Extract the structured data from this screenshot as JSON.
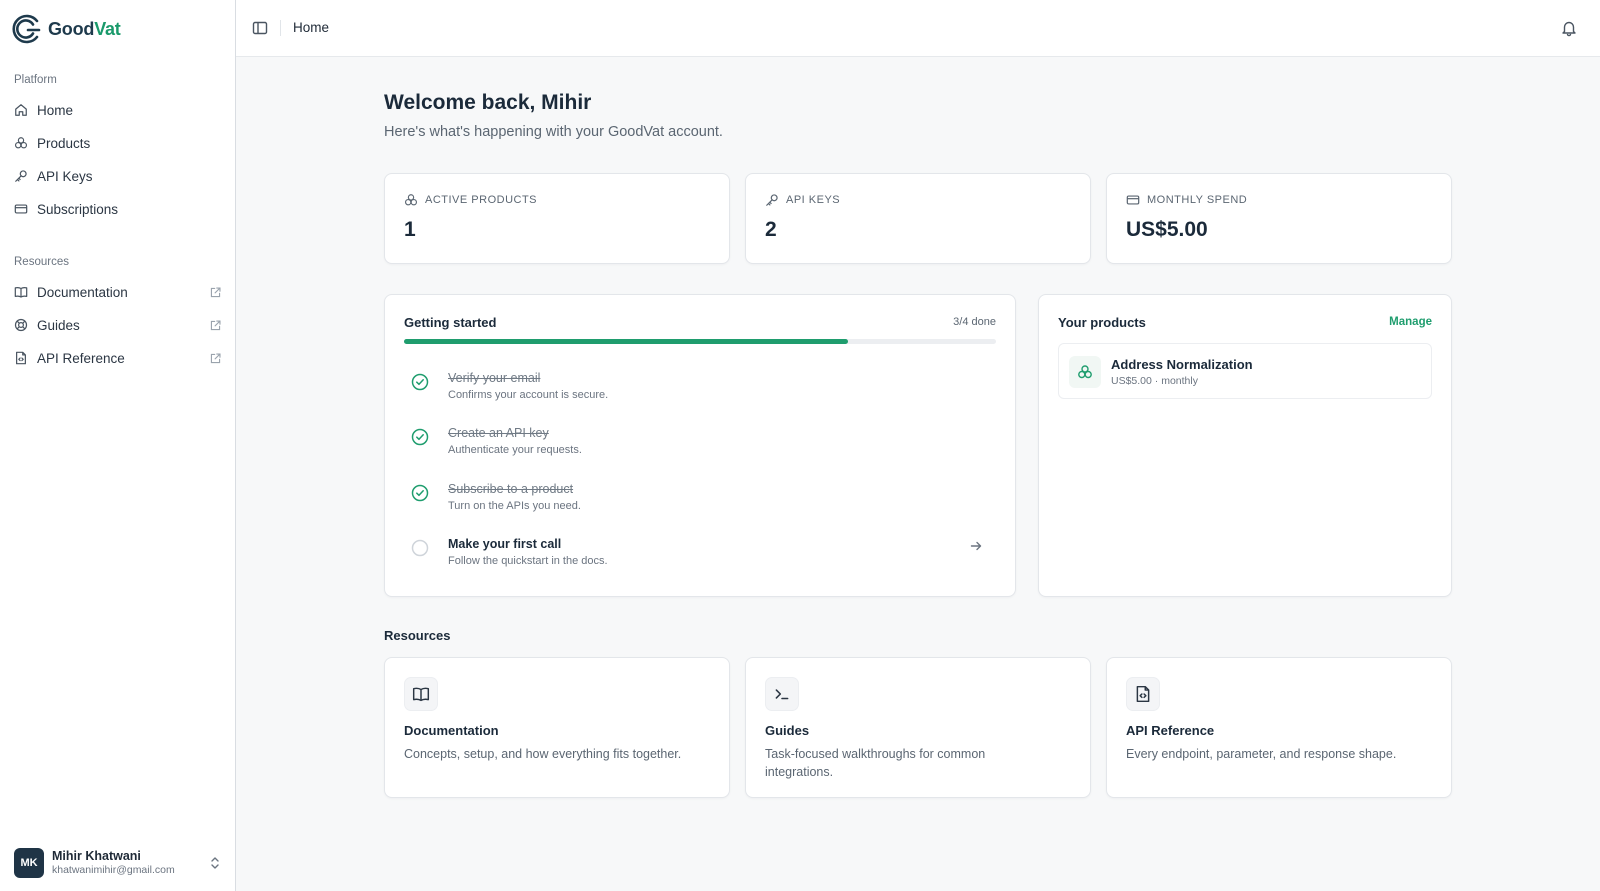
{
  "brand": {
    "name_part1": "Good",
    "name_part2": "Vat"
  },
  "sidebar": {
    "platform_title": "Platform",
    "platform_items": [
      {
        "label": "Home",
        "icon": "home-icon"
      },
      {
        "label": "Products",
        "icon": "products-icon"
      },
      {
        "label": "API Keys",
        "icon": "key-icon"
      },
      {
        "label": "Subscriptions",
        "icon": "credit-card-icon"
      }
    ],
    "resources_title": "Resources",
    "resource_items": [
      {
        "label": "Documentation",
        "icon": "book-icon"
      },
      {
        "label": "Guides",
        "icon": "lifebuoy-icon"
      },
      {
        "label": "API Reference",
        "icon": "file-code-icon"
      }
    ],
    "user": {
      "initials": "MK",
      "name": "Mihir Khatwani",
      "email": "khatwanimihir@gmail.com"
    }
  },
  "topbar": {
    "breadcrumb": "Home"
  },
  "welcome": {
    "title": "Welcome back, Mihir",
    "subtitle": "Here's what's happening with your GoodVat account."
  },
  "stats": [
    {
      "label": "Active products",
      "value": "1",
      "icon": "products-icon"
    },
    {
      "label": "API keys",
      "value": "2",
      "icon": "key-icon"
    },
    {
      "label": "Monthly spend",
      "value": "US$5.00",
      "icon": "credit-card-icon"
    }
  ],
  "getting_started": {
    "title": "Getting started",
    "count": "3/4 done",
    "progress": 0.75,
    "steps": [
      {
        "title": "Verify your email",
        "desc": "Confirms your account is secure.",
        "done": true
      },
      {
        "title": "Create an API key",
        "desc": "Authenticate your requests.",
        "done": true
      },
      {
        "title": "Subscribe to a product",
        "desc": "Turn on the APIs you need.",
        "done": true
      },
      {
        "title": "Make your first call",
        "desc": "Follow the quickstart in the docs.",
        "done": false
      }
    ]
  },
  "your_products": {
    "title": "Your products",
    "manage_label": "Manage",
    "items": [
      {
        "name": "Address Normalization",
        "meta": "US$5.00 · monthly"
      }
    ]
  },
  "resources": {
    "heading": "Resources",
    "cards": [
      {
        "title": "Documentation",
        "desc": "Concepts, setup, and how everything fits together.",
        "icon": "book-icon"
      },
      {
        "title": "Guides",
        "desc": "Task-focused walkthroughs for common integrations.",
        "icon": "terminal-icon"
      },
      {
        "title": "API Reference",
        "desc": "Every endpoint, parameter, and response shape.",
        "icon": "file-code-icon"
      }
    ]
  },
  "colors": {
    "accent": "#1f9d6e",
    "brand_dark": "#1e3a4c",
    "avatar_bg": "#1f3446"
  }
}
